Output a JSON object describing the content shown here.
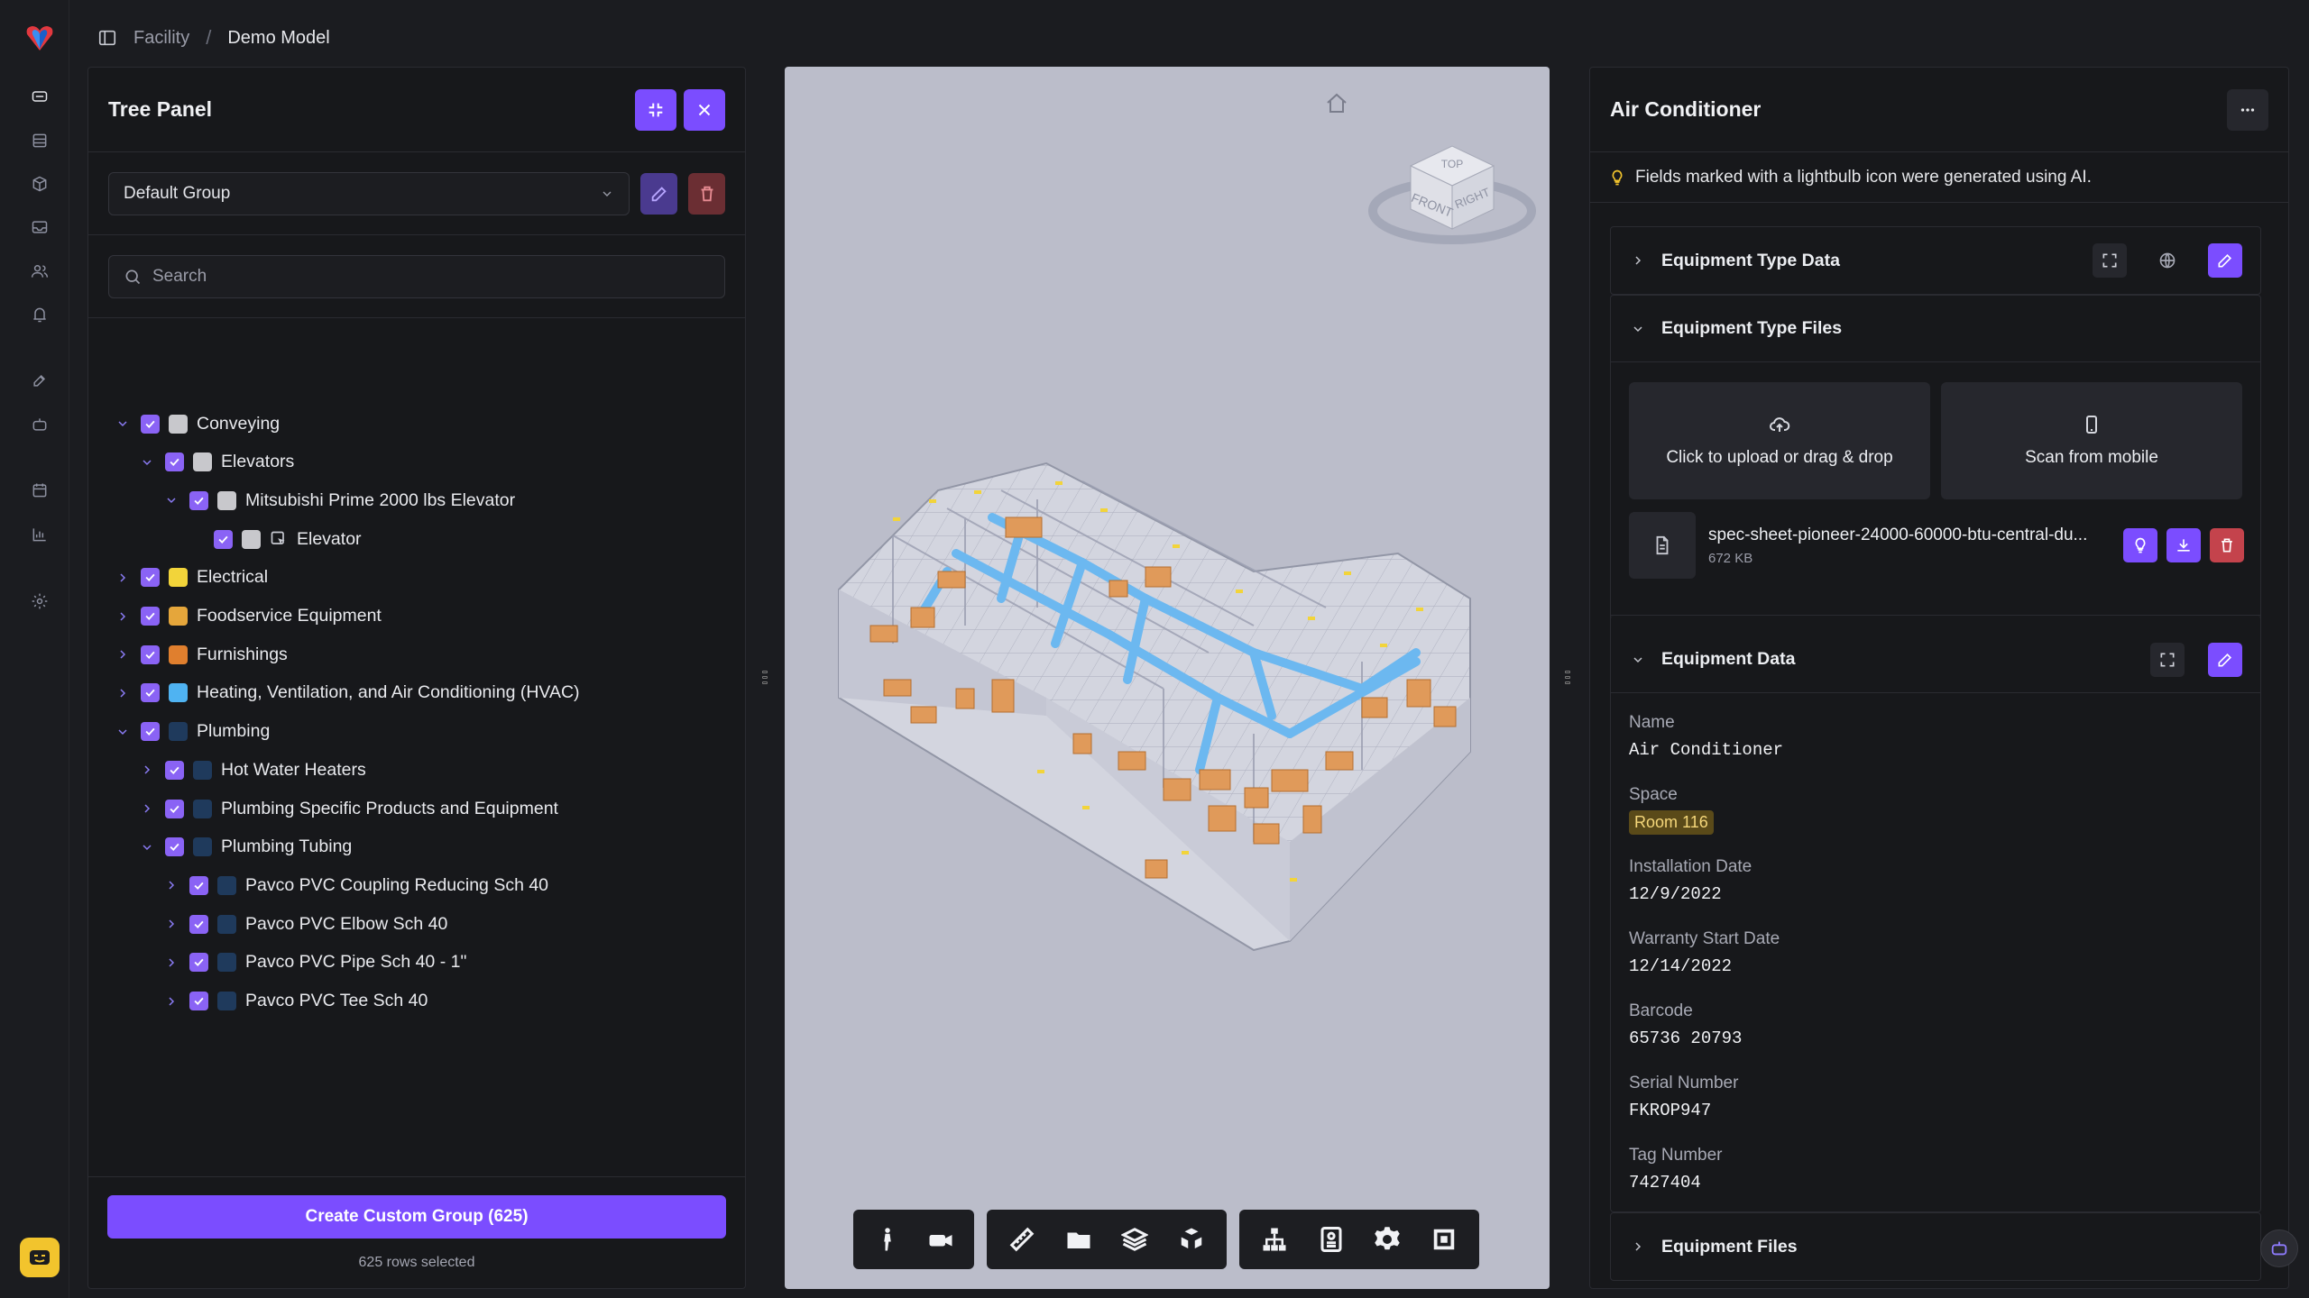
{
  "breadcrumb": {
    "parent": "Facility",
    "current": "Demo Model"
  },
  "tree_panel": {
    "title": "Tree Panel",
    "group_select": "Default Group",
    "search_placeholder": "Search",
    "items": [
      {
        "label": "Conveying",
        "depth": 0,
        "expanded": true,
        "has_children": true,
        "swatch": "#c8c8cc"
      },
      {
        "label": "Elevators",
        "depth": 1,
        "expanded": true,
        "has_children": true,
        "swatch": "#c8c8cc"
      },
      {
        "label": "Mitsubishi Prime 2000 lbs Elevator",
        "depth": 2,
        "expanded": true,
        "has_children": true,
        "swatch": "#c8c8cc"
      },
      {
        "label": "Elevator",
        "depth": 3,
        "expanded": false,
        "has_children": false,
        "swatch": "#c8c8cc",
        "element_icon": true
      },
      {
        "label": "Electrical",
        "depth": 0,
        "expanded": false,
        "has_children": true,
        "swatch": "#f2d43a"
      },
      {
        "label": "Foodservice Equipment",
        "depth": 0,
        "expanded": false,
        "has_children": true,
        "swatch": "#e5a63b"
      },
      {
        "label": "Furnishings",
        "depth": 0,
        "expanded": false,
        "has_children": true,
        "swatch": "#e07f2e"
      },
      {
        "label": "Heating, Ventilation, and Air Conditioning (HVAC)",
        "depth": 0,
        "expanded": false,
        "has_children": true,
        "swatch": "#4fb3f2"
      },
      {
        "label": "Plumbing",
        "depth": 0,
        "expanded": true,
        "has_children": true,
        "swatch": "#1f3a5c"
      },
      {
        "label": "Hot Water Heaters",
        "depth": 1,
        "expanded": false,
        "has_children": true,
        "swatch": "#1f3a5c"
      },
      {
        "label": "Plumbing Specific Products and Equipment",
        "depth": 1,
        "expanded": false,
        "has_children": true,
        "swatch": "#1f3a5c"
      },
      {
        "label": "Plumbing Tubing",
        "depth": 1,
        "expanded": true,
        "has_children": true,
        "swatch": "#1f3a5c"
      },
      {
        "label": "Pavco PVC Coupling Reducing Sch 40",
        "depth": 2,
        "expanded": false,
        "has_children": true,
        "swatch": "#1f3a5c"
      },
      {
        "label": "Pavco PVC Elbow Sch 40",
        "depth": 2,
        "expanded": false,
        "has_children": true,
        "swatch": "#1f3a5c"
      },
      {
        "label": "Pavco PVC Pipe Sch 40 - 1\"",
        "depth": 2,
        "expanded": false,
        "has_children": true,
        "swatch": "#1f3a5c"
      },
      {
        "label": "Pavco PVC Tee Sch 40",
        "depth": 2,
        "expanded": false,
        "has_children": true,
        "swatch": "#1f3a5c"
      }
    ],
    "create_button": "Create Custom Group (625)",
    "rows_selected": "625 rows selected"
  },
  "viewer": {
    "viewcube": {
      "top": "TOP",
      "front": "FRONT",
      "right": "RIGHT"
    },
    "toolbar_icons": [
      "walk-icon",
      "camera-icon",
      "measure-icon",
      "folder-icon",
      "layers-icon",
      "explode-icon",
      "tree-icon",
      "properties-icon",
      "settings-icon",
      "fullscreen-icon"
    ]
  },
  "details": {
    "title": "Air Conditioner",
    "ai_note": "Fields marked with a lightbulb icon were generated using AI.",
    "sections": {
      "type_data": "Equipment Type Data",
      "type_files": "Equipment Type Files",
      "data": "Equipment Data",
      "files": "Equipment Files"
    },
    "upload": {
      "click": "Click to upload or drag & drop",
      "scan": "Scan from mobile"
    },
    "file": {
      "name": "spec-sheet-pioneer-24000-60000-btu-central-du...",
      "size": "672 KB"
    },
    "fields": {
      "name_label": "Name",
      "name": "Air Conditioner",
      "space_label": "Space",
      "space": "Room 116",
      "install_label": "Installation Date",
      "install": "12/9/2022",
      "warranty_label": "Warranty Start Date",
      "warranty": "12/14/2022",
      "barcode_label": "Barcode",
      "barcode": "65736 20793",
      "serial_label": "Serial Number",
      "serial": "FKROP947",
      "tag_label": "Tag Number",
      "tag": "7427404"
    }
  },
  "colors": {
    "accent": "#7b4dff",
    "background": "#1b1c20",
    "panel": "#17181b",
    "viewer_bg": "#bbbdca"
  }
}
